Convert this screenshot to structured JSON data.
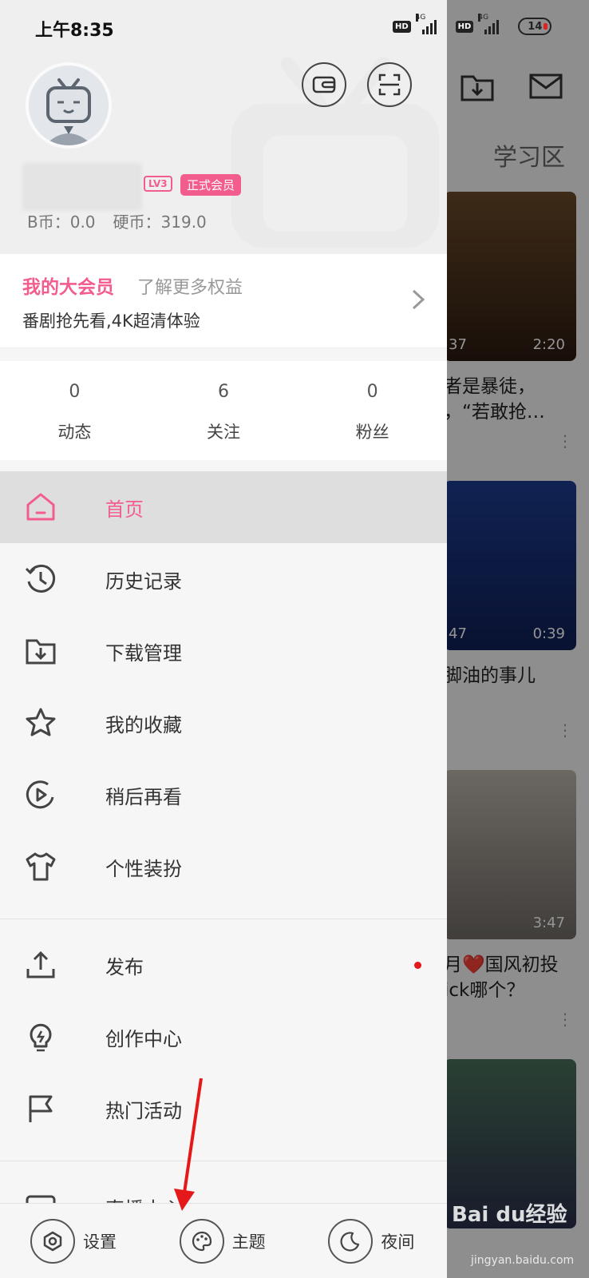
{
  "status_bar": {
    "time": "上午8:35",
    "network_1": "4G",
    "network_2": "4G",
    "battery": "14"
  },
  "background": {
    "tab": "学习区",
    "cards": [
      {
        "count": "37",
        "duration": "2:20",
        "title_line1": "者是暴徒，",
        "title_line2": "，“若敢抢…"
      },
      {
        "count": "47",
        "duration": "0:39",
        "title_line1": "脚油的事儿",
        "title_line2": ""
      },
      {
        "count": "",
        "duration": "3:47",
        "title_line1": "月❤️国风初投",
        "title_line2": "ick哪个？"
      },
      {
        "count": "",
        "duration": "",
        "title_line1": "",
        "title_line2": ""
      }
    ]
  },
  "profile": {
    "level": "LV3",
    "membership": "正式会员",
    "bcoin": "B币：0.0",
    "coins": "硬币：319.0"
  },
  "vip": {
    "title": "我的大会员",
    "more": "了解更多权益",
    "desc": "番剧抢先看,4K超清体验"
  },
  "stats": [
    {
      "value": "0",
      "label": "动态"
    },
    {
      "value": "6",
      "label": "关注"
    },
    {
      "value": "0",
      "label": "粉丝"
    }
  ],
  "menu": {
    "group1": [
      {
        "label": "首页",
        "icon": "home-icon"
      },
      {
        "label": "历史记录",
        "icon": "history-icon"
      },
      {
        "label": "下载管理",
        "icon": "download-icon"
      },
      {
        "label": "我的收藏",
        "icon": "star-icon"
      },
      {
        "label": "稍后再看",
        "icon": "watch-later-icon"
      },
      {
        "label": "个性装扮",
        "icon": "tshirt-icon"
      }
    ],
    "group2": [
      {
        "label": "发布",
        "icon": "upload-icon"
      },
      {
        "label": "创作中心",
        "icon": "lightbulb-icon"
      },
      {
        "label": "热门活动",
        "icon": "flag-icon"
      }
    ],
    "group3": [
      {
        "label": "直播中心",
        "icon": "live-icon"
      }
    ]
  },
  "bottom_bar": [
    {
      "label": "设置",
      "icon": "settings-icon"
    },
    {
      "label": "主题",
      "icon": "palette-icon"
    },
    {
      "label": "夜间",
      "icon": "moon-icon"
    }
  ],
  "watermark": {
    "brand": "Bai du经验",
    "url": "jingyan.baidu.com"
  },
  "colors": {
    "accent": "#f25d8e",
    "dot": "#e5191a",
    "arrow": "#e5191a"
  }
}
